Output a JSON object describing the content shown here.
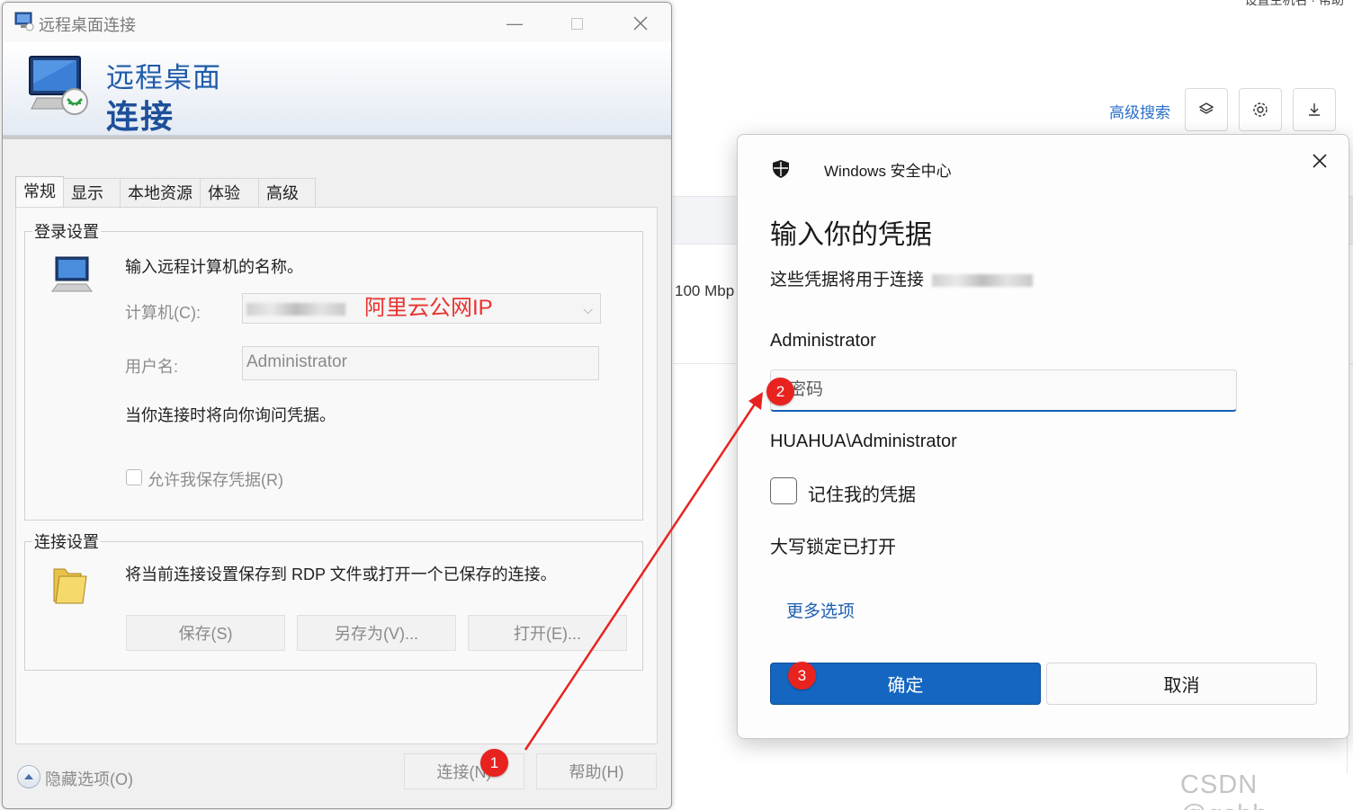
{
  "background": {
    "advanced_search": "高级搜索",
    "speed": "100 Mbp",
    "top_right_fragment": "设置主机名  ·  帮助"
  },
  "rdp": {
    "window_title": "远程桌面连接",
    "banner_line1": "远程桌面",
    "banner_line2": "连接",
    "tabs": [
      "常规",
      "显示",
      "本地资源",
      "体验",
      "高级"
    ],
    "login_group": "登录设置",
    "login_prompt": "输入远程计算机的名称。",
    "computer_label": "计算机(C):",
    "computer_annotation": "阿里云公网IP",
    "username_label": "用户名:",
    "username_value": "Administrator",
    "ask_credentials": "当你连接时将向你询问凭据。",
    "allow_save": "允许我保存凭据(R)",
    "connect_group": "连接设置",
    "connect_desc": "将当前连接设置保存到 RDP 文件或打开一个已保存的连接。",
    "save_btn": "保存(S)",
    "saveas_btn": "另存为(V)...",
    "open_btn": "打开(E)...",
    "hide_options": "隐藏选项(O)",
    "connect_btn": "连接(N)",
    "help_btn": "帮助(H)"
  },
  "security": {
    "app_name": "Windows 安全中心",
    "heading": "输入你的凭据",
    "subtitle": "这些凭据将用于连接",
    "user": "Administrator",
    "password_placeholder": "密码",
    "domain_user": "HUAHUA\\Administrator",
    "remember": "记住我的凭据",
    "caps_lock": "大写锁定已打开",
    "more_options": "更多选项",
    "ok": "确定",
    "cancel": "取消"
  },
  "annotations": {
    "badge1": "1",
    "badge2": "2",
    "badge3": "3",
    "arrow_color": "#e8231f"
  },
  "watermark": "CSDN @gshh_",
  "colors": {
    "accent": "#1466c0",
    "link": "#1d5fb1",
    "annotation": "#e8231f"
  }
}
